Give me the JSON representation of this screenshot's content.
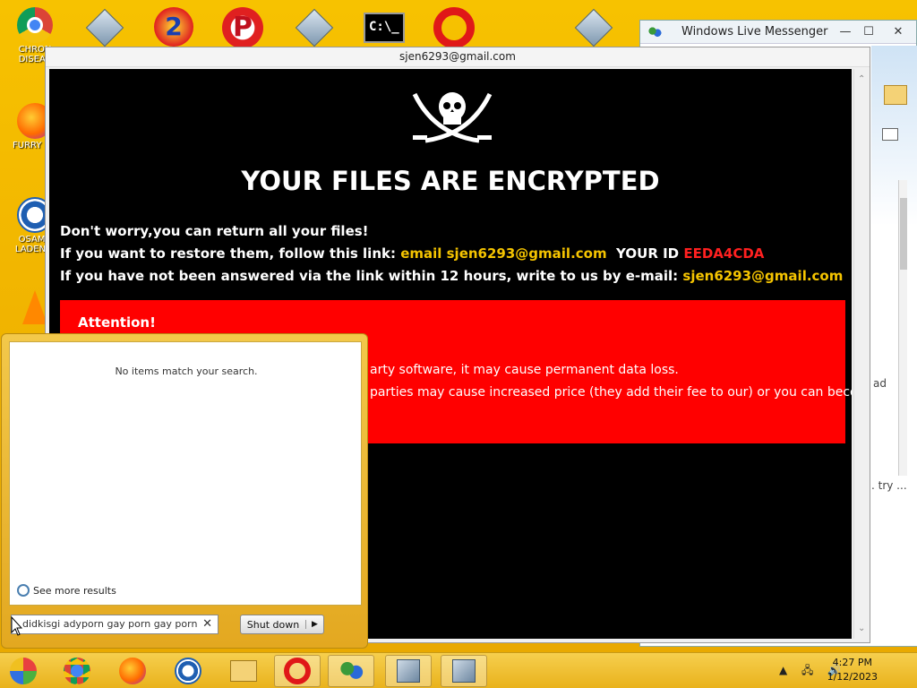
{
  "desktop": {
    "icons": [
      {
        "label1": "CHRON",
        "label2": "DISEAS"
      },
      {
        "label1": "FURRY CU",
        "label2": ""
      },
      {
        "label1": "OSAMA",
        "label2": "LADEN B"
      },
      {
        "label1": "",
        "label2": ""
      }
    ],
    "top_icons": [
      "installer-icon",
      "two-icon",
      "p-icon",
      "installer-icon",
      "cmd-icon",
      "opera-icon",
      "installer-icon"
    ],
    "cmd_text": "C:\\_"
  },
  "messenger": {
    "title": "Windows Live Messenger",
    "minimize": "—",
    "maximize": "☐",
    "close": "✕",
    "frag_ad": "ad",
    "frag_try": ". try ..."
  },
  "ransom": {
    "window_title": "sjen6293@gmail.com",
    "headline": "YOUR FILES ARE ENCRYPTED",
    "line1": "Don't worry,you can return all your files!",
    "line2_prefix": "If you want to restore them, follow this link: ",
    "line2_email": "email sjen6293@gmail.com",
    "line2_id_label": "  YOUR ID ",
    "line2_id": "EEDA4CDA",
    "line3_prefix": "If you have not been answered via the link within 12 hours, write to us by e-mail: ",
    "line3_email": "sjen6293@gmail.com",
    "attention_title": "Attention!",
    "attention_p1": "arty software, it may cause permanent data loss.",
    "attention_p2": "parties may cause increased price (they add their fee to our) or you can become"
  },
  "start_menu": {
    "no_items": "No items match your search.",
    "see_more": "See more results",
    "search_value": "didkisgi adyporn gay porn gay porn",
    "clear": "✕",
    "shutdown": "Shut down",
    "shutdown_arrow": "▶"
  },
  "taskbar": {
    "time": "4:27 PM",
    "date": "1/12/2023",
    "tray": "▲ 🖧 🔊"
  },
  "colors": {
    "desktop": "#f0b800",
    "attention_bg": "#ff0000",
    "email_yellow": "#f5c400",
    "id_red": "#ff2020"
  }
}
